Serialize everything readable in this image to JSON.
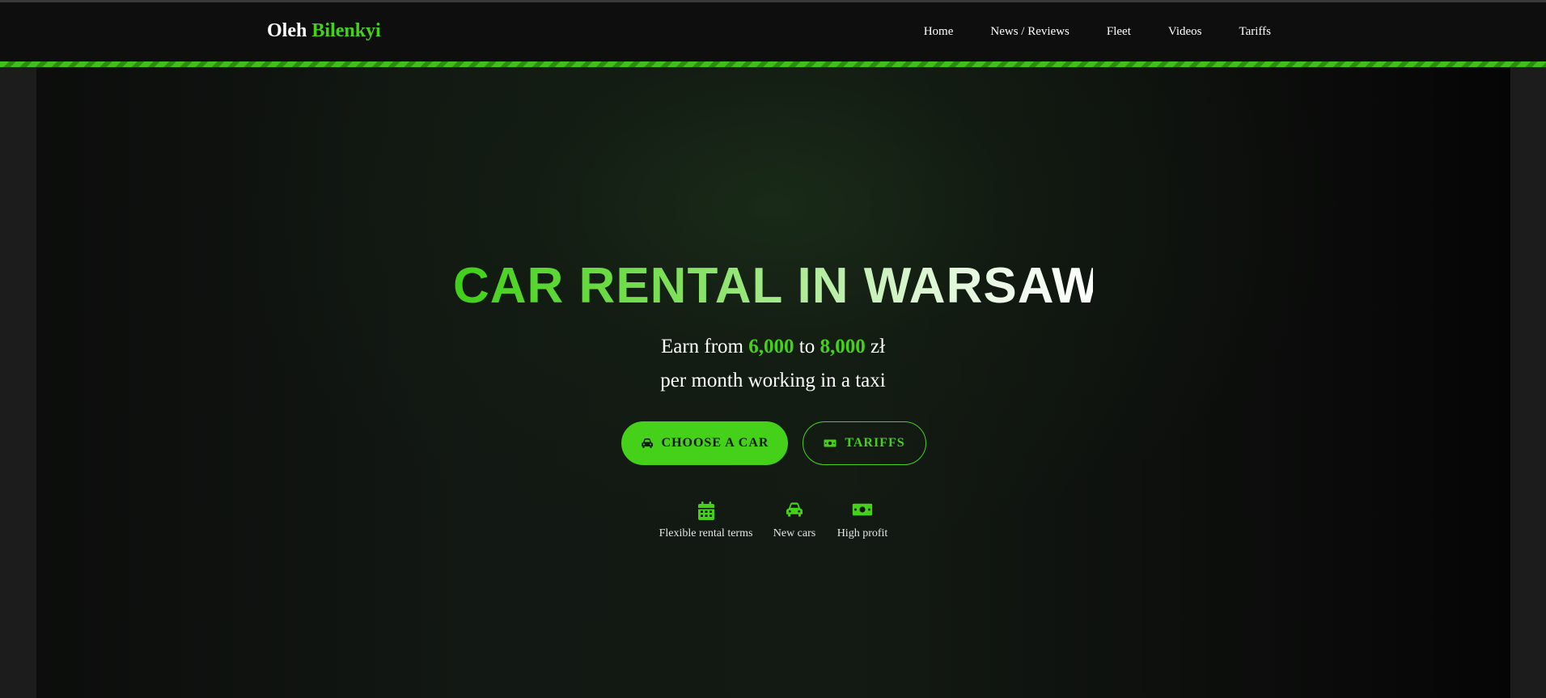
{
  "header": {
    "logo_first": "Oleh",
    "logo_second": "Bilenkyi",
    "nav": [
      "Home",
      "News / Reviews",
      "Fleet",
      "Videos",
      "Tariffs"
    ]
  },
  "hero": {
    "title": "CAR RENTAL IN WARSAW",
    "earn_prefix": "Earn from",
    "earn_min": "6,000",
    "earn_to": "to",
    "earn_max": "8,000",
    "currency": "zł",
    "subline": "per month working in a taxi",
    "primary_button": "CHOOSE A CAR",
    "secondary_button": "TARIFFS",
    "features": [
      {
        "icon": "calendar-icon",
        "label": "Flexible rental terms"
      },
      {
        "icon": "car-icon",
        "label": "New cars"
      },
      {
        "icon": "money-icon",
        "label": "High profit"
      }
    ]
  },
  "colors": {
    "accent": "#45d119",
    "header_bg": "#0e0e0e",
    "text": "#ffffff"
  }
}
